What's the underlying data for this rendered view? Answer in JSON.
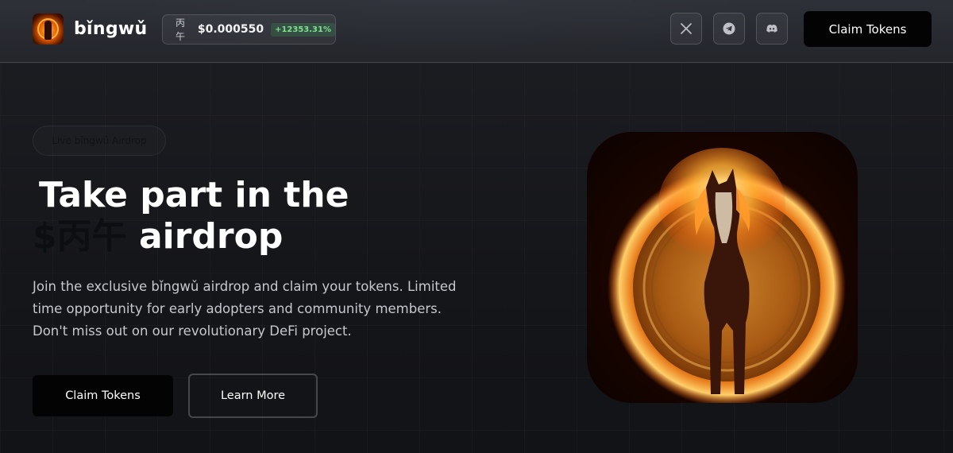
{
  "header": {
    "brand": "bǐngwǔ",
    "ticker": {
      "symbol": "丙午",
      "price": "$0.000550",
      "change": "+12353.31%"
    },
    "social": [
      {
        "name": "x",
        "icon": "x-icon"
      },
      {
        "name": "telegram",
        "icon": "telegram-icon"
      },
      {
        "name": "discord",
        "icon": "discord-icon"
      }
    ],
    "cta_label": "Claim Tokens"
  },
  "hero": {
    "badge": "Live bǐngwǔ Airdrop",
    "title_line1": "Take part in the",
    "title_token": "$丙午",
    "title_rest": " airdrop",
    "description": "Join the exclusive bǐngwǔ airdrop and claim your tokens. Limited time opportunity for early adopters and community members. Don't miss out on our revolutionary DeFi project.",
    "primary_button": "Claim Tokens",
    "secondary_button": "Learn More",
    "image_icon": "fire-horse-coin-image"
  },
  "colors": {
    "background": "#16171b",
    "header": "#2a2c32",
    "button": "#030303",
    "change_positive": "#7ee08f",
    "fire": "#ff8a1f"
  }
}
